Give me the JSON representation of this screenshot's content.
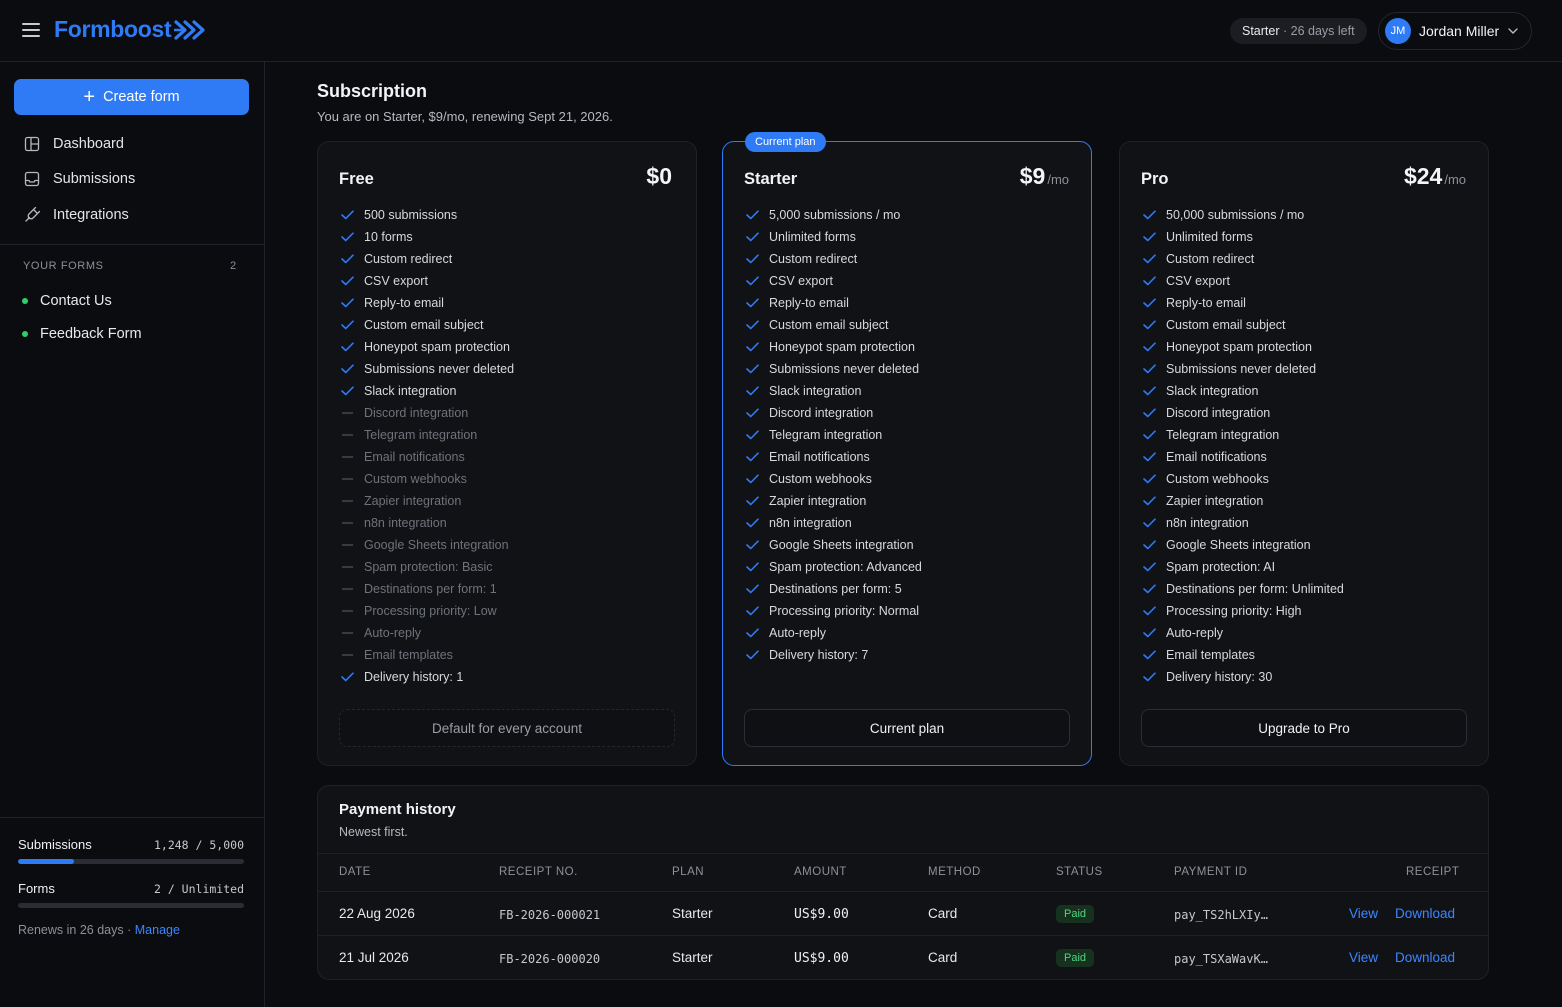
{
  "header": {
    "logo_text": "Formboost",
    "trial_plan": "Starter",
    "trial_days": "· 26 days left",
    "user_initials": "JM",
    "user_name": "Jordan Miller"
  },
  "sidebar": {
    "create_label": "Create form",
    "nav": [
      {
        "label": "Dashboard",
        "icon": "dashboard-icon"
      },
      {
        "label": "Submissions",
        "icon": "inbox-icon"
      },
      {
        "label": "Integrations",
        "icon": "plug-icon"
      }
    ],
    "forms_heading": "YOUR FORMS",
    "forms_count": "2",
    "forms": [
      {
        "label": "Contact Us"
      },
      {
        "label": "Feedback Form"
      }
    ],
    "usage": {
      "submissions_label": "Submissions",
      "submissions_value": "1,248 / 5,000",
      "submissions_fraction": 0.2496,
      "forms_label": "Forms",
      "forms_value": "2 / Unlimited",
      "forms_fraction": 0,
      "renews_text": "Renews in 26 days ·",
      "manage_label": "Manage"
    }
  },
  "main": {
    "title": "Subscription",
    "subtitle": "You are on Starter, $9/mo, renewing Sept 21, 2026."
  },
  "plans": [
    {
      "name": "Free",
      "price": "$0",
      "per": "",
      "badge": "",
      "button": "Default for every account",
      "button_state": "disabled",
      "features": [
        {
          "text": "500 submissions",
          "on": true
        },
        {
          "text": "10 forms",
          "on": true
        },
        {
          "text": "Custom redirect",
          "on": true
        },
        {
          "text": "CSV export",
          "on": true
        },
        {
          "text": "Reply-to email",
          "on": true
        },
        {
          "text": "Custom email subject",
          "on": true
        },
        {
          "text": "Honeypot spam protection",
          "on": true
        },
        {
          "text": "Submissions never deleted",
          "on": true
        },
        {
          "text": "Slack integration",
          "on": true
        },
        {
          "text": "Discord integration",
          "on": false
        },
        {
          "text": "Telegram integration",
          "on": false
        },
        {
          "text": "Email notifications",
          "on": false
        },
        {
          "text": "Custom webhooks",
          "on": false
        },
        {
          "text": "Zapier integration",
          "on": false
        },
        {
          "text": "n8n integration",
          "on": false
        },
        {
          "text": "Google Sheets integration",
          "on": false
        },
        {
          "text": "Spam protection: Basic",
          "on": false
        },
        {
          "text": "Destinations per form: 1",
          "on": false
        },
        {
          "text": "Processing priority: Low",
          "on": false
        },
        {
          "text": "Auto-reply",
          "on": false
        },
        {
          "text": "Email templates",
          "on": false
        },
        {
          "text": "Delivery history: 1",
          "on": true
        }
      ]
    },
    {
      "name": "Starter",
      "price": "$9",
      "per": "/mo",
      "badge": "Current plan",
      "button": "Current plan",
      "button_state": "current",
      "features": [
        {
          "text": "5,000 submissions / mo",
          "on": true
        },
        {
          "text": "Unlimited forms",
          "on": true
        },
        {
          "text": "Custom redirect",
          "on": true
        },
        {
          "text": "CSV export",
          "on": true
        },
        {
          "text": "Reply-to email",
          "on": true
        },
        {
          "text": "Custom email subject",
          "on": true
        },
        {
          "text": "Honeypot spam protection",
          "on": true
        },
        {
          "text": "Submissions never deleted",
          "on": true
        },
        {
          "text": "Slack integration",
          "on": true
        },
        {
          "text": "Discord integration",
          "on": true
        },
        {
          "text": "Telegram integration",
          "on": true
        },
        {
          "text": "Email notifications",
          "on": true
        },
        {
          "text": "Custom webhooks",
          "on": true
        },
        {
          "text": "Zapier integration",
          "on": true
        },
        {
          "text": "n8n integration",
          "on": true
        },
        {
          "text": "Google Sheets integration",
          "on": true
        },
        {
          "text": "Spam protection: Advanced",
          "on": true
        },
        {
          "text": "Destinations per form: 5",
          "on": true
        },
        {
          "text": "Processing priority: Normal",
          "on": true
        },
        {
          "text": "Auto-reply",
          "on": true
        },
        {
          "text": "Delivery history: 7",
          "on": true
        }
      ]
    },
    {
      "name": "Pro",
      "price": "$24",
      "per": "/mo",
      "badge": "",
      "button": "Upgrade to Pro",
      "button_state": "action",
      "features": [
        {
          "text": "50,000 submissions / mo",
          "on": true
        },
        {
          "text": "Unlimited forms",
          "on": true
        },
        {
          "text": "Custom redirect",
          "on": true
        },
        {
          "text": "CSV export",
          "on": true
        },
        {
          "text": "Reply-to email",
          "on": true
        },
        {
          "text": "Custom email subject",
          "on": true
        },
        {
          "text": "Honeypot spam protection",
          "on": true
        },
        {
          "text": "Submissions never deleted",
          "on": true
        },
        {
          "text": "Slack integration",
          "on": true
        },
        {
          "text": "Discord integration",
          "on": true
        },
        {
          "text": "Telegram integration",
          "on": true
        },
        {
          "text": "Email notifications",
          "on": true
        },
        {
          "text": "Custom webhooks",
          "on": true
        },
        {
          "text": "Zapier integration",
          "on": true
        },
        {
          "text": "n8n integration",
          "on": true
        },
        {
          "text": "Google Sheets integration",
          "on": true
        },
        {
          "text": "Spam protection: AI",
          "on": true
        },
        {
          "text": "Destinations per form: Unlimited",
          "on": true
        },
        {
          "text": "Processing priority: High",
          "on": true
        },
        {
          "text": "Auto-reply",
          "on": true
        },
        {
          "text": "Email templates",
          "on": true
        },
        {
          "text": "Delivery history: 30",
          "on": true
        }
      ]
    }
  ],
  "payments": {
    "title": "Payment history",
    "subtitle": "Newest first.",
    "columns": [
      "DATE",
      "RECEIPT NO.",
      "PLAN",
      "AMOUNT",
      "METHOD",
      "STATUS",
      "PAYMENT ID",
      "RECEIPT"
    ],
    "rows": [
      {
        "date": "22 Aug 2026",
        "receipt": "FB-2026-000021",
        "plan": "Starter",
        "amount": "US$9.00",
        "method": "Card",
        "status": "Paid",
        "payment_id": "pay_TS2hLXIy…",
        "view": "View",
        "download": "Download"
      },
      {
        "date": "21 Jul 2026",
        "receipt": "FB-2026-000020",
        "plan": "Starter",
        "amount": "US$9.00",
        "method": "Card",
        "status": "Paid",
        "payment_id": "pay_TSXaWavK…",
        "view": "View",
        "download": "Download"
      }
    ]
  },
  "colors": {
    "accent": "#2f7bf5",
    "background": "#0b0c0f",
    "card": "#111216",
    "success": "#4fd47e"
  }
}
